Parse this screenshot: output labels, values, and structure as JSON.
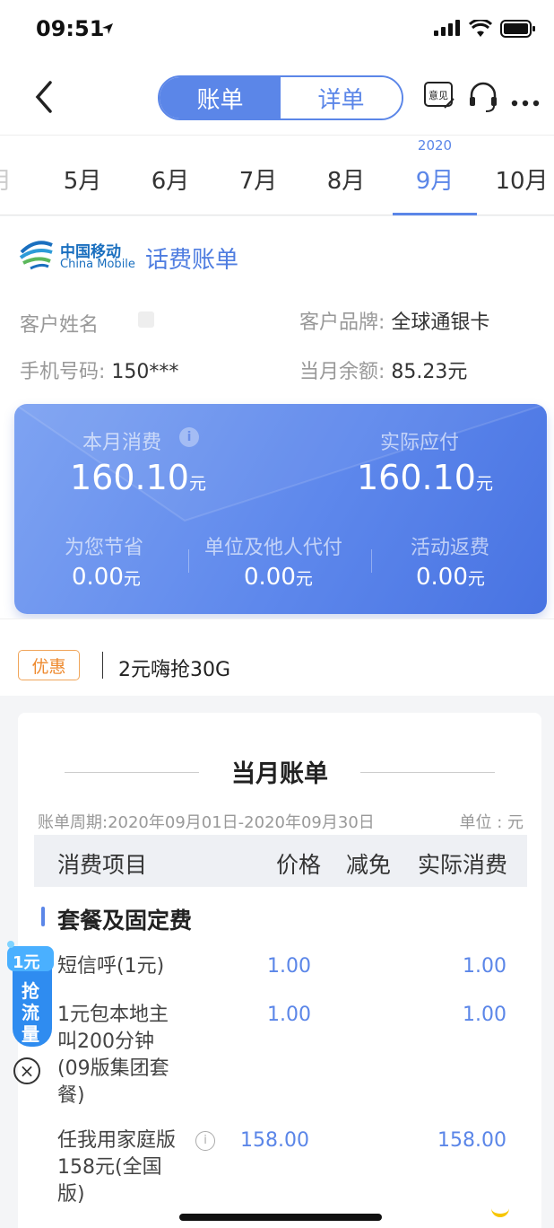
{
  "status_bar": {
    "time": "09:51"
  },
  "nav": {
    "tab_bill": "账单",
    "tab_detail": "详单",
    "feedback_label": "意见"
  },
  "months": {
    "year": "2020",
    "items": [
      "5月",
      "6月",
      "7月",
      "8月",
      "9月",
      "10月"
    ],
    "active": "9月"
  },
  "info": {
    "brand_cn": "中国移动",
    "brand_en": "China Mobile",
    "title": "话费账单",
    "customer_name_label": "客户姓名",
    "customer_brand_label": "客户品牌:",
    "customer_brand": "全球通银卡",
    "phone_label": "手机号码:",
    "phone": "150***",
    "balance_label": "当月余额:",
    "balance": "85.23元"
  },
  "summary": {
    "month_spend_label": "本月消费",
    "month_spend": "160.10",
    "actual_pay_label": "实际应付",
    "actual_pay": "160.10",
    "currency": "元",
    "saved_label": "为您节省",
    "saved": "0.00",
    "proxy_label": "单位及他人代付",
    "proxy": "0.00",
    "rebate_label": "活动返费",
    "rebate": "0.00"
  },
  "promo": {
    "badge": "优惠",
    "text": "2元嗨抢30G"
  },
  "bill": {
    "title": "当月账单",
    "period": "账单周期:2020年09月01日-2020年09月30日",
    "unit": "单位 : 元",
    "headers": [
      "消费项目",
      "价格",
      "减免",
      "实际消费"
    ],
    "section": "套餐及固定费",
    "rows": [
      {
        "name": "短信呼(1元)",
        "price": "1.00",
        "actual": "1.00"
      },
      {
        "name": "1元包本地主叫200分钟(09版集团套餐)",
        "name_lines": [
          "1元包本地主",
          "叫200分钟",
          "(09版集团套",
          "餐)"
        ],
        "price": "1.00",
        "actual": "1.00"
      },
      {
        "name": "任我用家庭版158元(全国版)",
        "name_lines": [
          "任我用家庭版",
          "158元(全国",
          "版)"
        ],
        "price": "158.00",
        "actual": "158.00"
      }
    ]
  },
  "floater": {
    "amount": "1元",
    "text": [
      "抢",
      "流",
      "量"
    ]
  }
}
